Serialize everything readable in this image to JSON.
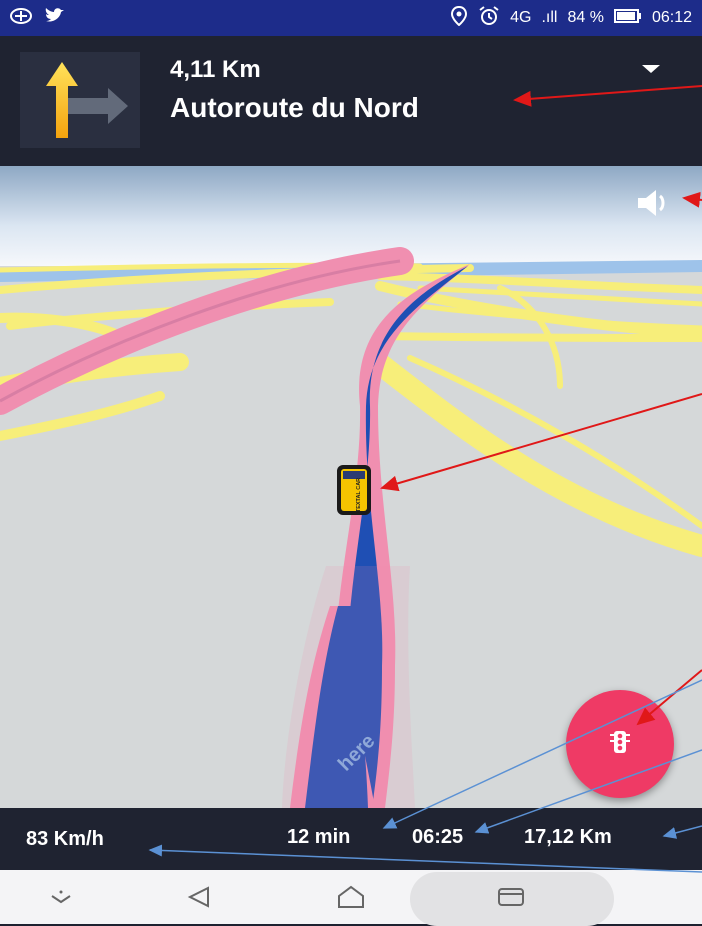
{
  "status_bar": {
    "left_icons": [
      "no-signal-icon",
      "twitter-icon"
    ],
    "location_icon": "location-icon",
    "alarm_icon": "alarm-icon",
    "network": "4G",
    "signal": ".ıll",
    "battery": "84 %",
    "time": "06:12"
  },
  "navigation": {
    "distance": "4,11 Km",
    "street": "Autoroute du Nord",
    "turn_icon": "turn-arrow-icon",
    "dropdown_icon": "chevron-down-icon"
  },
  "map": {
    "vehicle_label": "TEXTAL CAR",
    "provider_logo": "here",
    "sound_icon": "speaker-icon",
    "traffic_icon": "traffic-light-icon",
    "colors": {
      "route": "#1f4fb4",
      "route_border": "#f08fb0",
      "roads": "#f7ee7a",
      "ground": "#d5d8d9",
      "fab": "#ef3a65"
    }
  },
  "footer": {
    "speed": "83 Km/h",
    "eta": "12 min",
    "arrival": "06:25",
    "remaining": "17,12 Km"
  },
  "system_nav": {
    "icons": [
      "chevron-down-icon",
      "back-icon",
      "home-icon",
      "recents-icon"
    ]
  }
}
